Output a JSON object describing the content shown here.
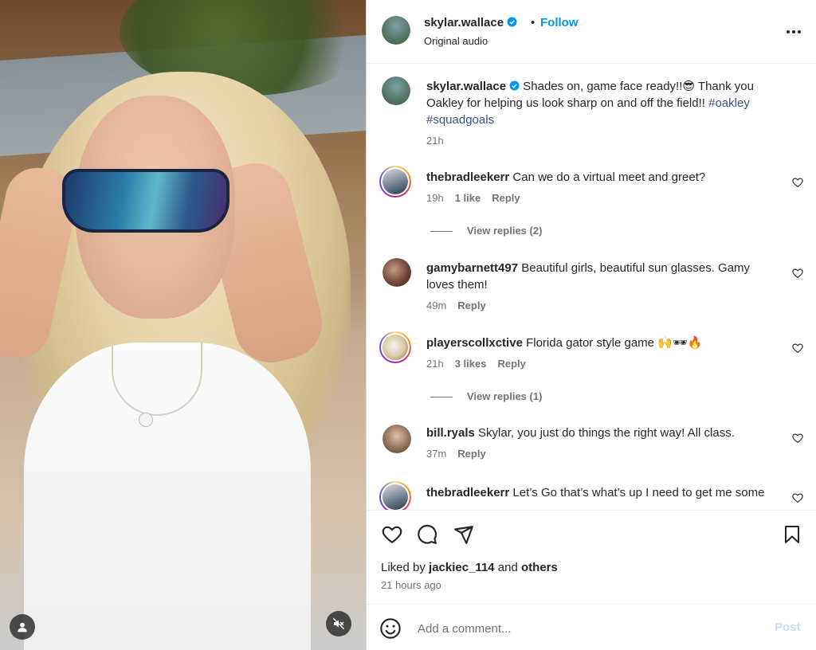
{
  "header": {
    "username": "skylar.wallace",
    "follow_label": "Follow",
    "separator": "•",
    "subtitle": "Original audio",
    "more_icon": "more-horizontal-icon"
  },
  "caption": {
    "username": "skylar.wallace",
    "text": "Shades on, game face ready!!😎 Thank you Oakley for helping us look sharp on and off the field!! ",
    "hashtag1": "#oakley",
    "hashtag2": "#squadgoals",
    "time": "21h"
  },
  "comments": [
    {
      "username": "thebradleekerr",
      "text": "Can we do a virtual meet and greet?",
      "time": "19h",
      "likes": "1 like",
      "reply": "Reply",
      "view_replies": "View replies (2)"
    },
    {
      "username": "gamybarnett497",
      "text": "Beautiful girls, beautiful sun glasses. Gamy loves them!",
      "time": "49m",
      "reply": "Reply"
    },
    {
      "username": "playerscollxctive",
      "text": "Florida gator style game 🙌🕶🔥",
      "time": "21h",
      "likes": "3 likes",
      "reply": "Reply",
      "view_replies": "View replies (1)"
    },
    {
      "username": "bill.ryals",
      "text": "Skylar, you just do things the right way! All class.",
      "time": "37m",
      "reply": "Reply"
    },
    {
      "username": "thebradleekerr",
      "text": "Let’s Go that’s what’s up I need to get me some"
    }
  ],
  "actions": {
    "liked_prefix": "Liked by ",
    "liked_user": "jackiec_114",
    "liked_and": " and ",
    "liked_others": "others",
    "posted_ago": "21 hours ago"
  },
  "add_comment": {
    "placeholder": "Add a comment...",
    "post_label": "Post"
  },
  "colors": {
    "accent": "#0095f6",
    "hashtag": "#385185",
    "muted": "#737373",
    "post_disabled": "#c0dffd"
  }
}
